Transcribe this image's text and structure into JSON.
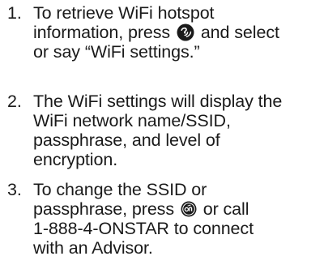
{
  "steps": [
    {
      "number": "1.",
      "line1": "To retrieve WiFi hotspot",
      "line2_before": "information, press",
      "line2_after": "and select",
      "line3": "or say “WiFi settings.”",
      "icon": "voice-command-icon"
    },
    {
      "number": "2.",
      "line1": "The WiFi settings will display the",
      "line2": "WiFi network name/SSID,",
      "line3": "passphrase, and level of",
      "line4": "encryption."
    },
    {
      "number": "3.",
      "line1": "To change the SSID or",
      "line2_before": "passphrase, press",
      "line2_after": "or call",
      "line3": "1-888-4-ONSTAR to connect",
      "line4": "with an Advisor.",
      "icon": "onstar-button-icon"
    }
  ],
  "colors": {
    "text": "#1a1a1a",
    "icon": "#1a1a1a",
    "background": "#ffffff"
  }
}
